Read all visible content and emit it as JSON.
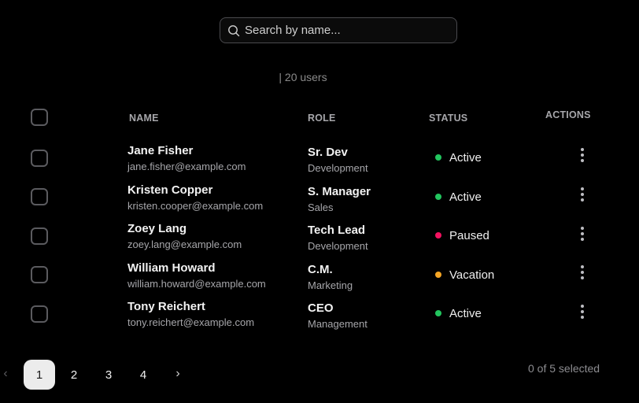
{
  "search": {
    "placeholder": "Search by name...",
    "value": ""
  },
  "summary": {
    "count_text": "| 20 users"
  },
  "table": {
    "headers": {
      "name": "NAME",
      "role": "ROLE",
      "status": "STATUS",
      "actions": "ACTIONS"
    },
    "rows": [
      {
        "name": "Jane Fisher",
        "email": "jane.fisher@example.com",
        "role": "Sr. Dev",
        "department": "Development",
        "status": "Active",
        "status_color": "#22c55e"
      },
      {
        "name": "Kristen Copper",
        "email": "kristen.cooper@example.com",
        "role": "S. Manager",
        "department": "Sales",
        "status": "Active",
        "status_color": "#22c55e"
      },
      {
        "name": "Zoey Lang",
        "email": "zoey.lang@example.com",
        "role": "Tech Lead",
        "department": "Development",
        "status": "Paused",
        "status_color": "#f31260"
      },
      {
        "name": "William Howard",
        "email": "william.howard@example.com",
        "role": "C.M.",
        "department": "Marketing",
        "status": "Vacation",
        "status_color": "#f5a524"
      },
      {
        "name": "Tony Reichert",
        "email": "tony.reichert@example.com",
        "role": "CEO",
        "department": "Management",
        "status": "Active",
        "status_color": "#22c55e"
      }
    ]
  },
  "pagination": {
    "prev_icon": "chevron-left-icon",
    "next_icon": "chevron-right-icon",
    "pages": [
      "1",
      "2",
      "3",
      "4"
    ],
    "current": "1"
  },
  "selection": {
    "text": "0 of 5 selected"
  },
  "icons": {
    "search": "search-icon",
    "row_actions": "more-vertical-icon"
  },
  "colors": {
    "background": "#000000",
    "active": "#22c55e",
    "paused": "#f31260",
    "vacation": "#f5a524",
    "current_page_bg": "#ececec"
  }
}
